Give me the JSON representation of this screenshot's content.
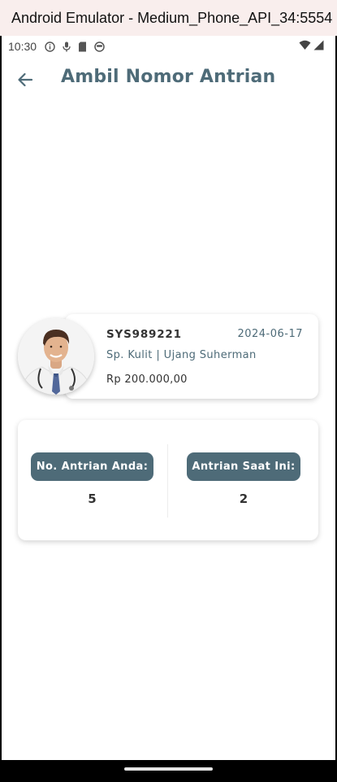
{
  "window": {
    "title": "Android Emulator - Medium_Phone_API_34:5554"
  },
  "status_bar": {
    "time": "10:30"
  },
  "app_bar": {
    "title": "Ambil Nomor Antrian"
  },
  "doctor": {
    "code": "SYS989221",
    "date": "2024-06-17",
    "specialty_name": "Sp. Kulit | Ujang Suherman",
    "price": "Rp 200.000,00"
  },
  "queue": {
    "your_number_label": "No. Antrian Anda:",
    "your_number": "5",
    "current_label": "Antrian Saat Ini:",
    "current_number": "2"
  },
  "colors": {
    "accent": "#4e6b78",
    "text_dark": "#333333"
  }
}
